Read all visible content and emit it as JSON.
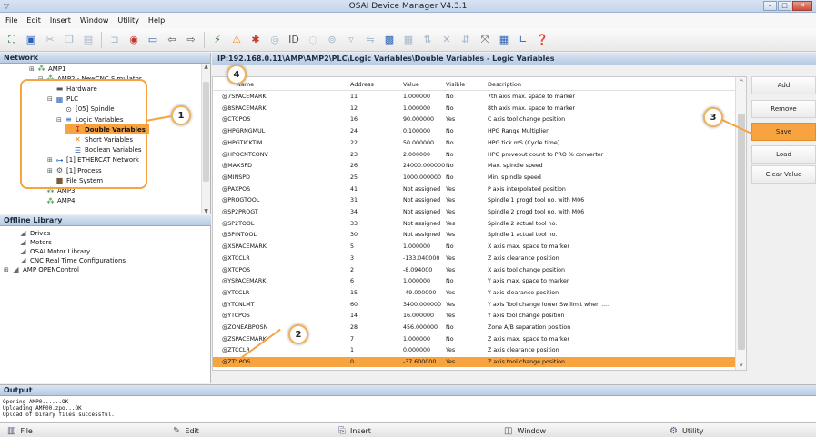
{
  "window": {
    "title": "OSAI Device Manager  V4.3.1"
  },
  "menu": [
    "File",
    "Edit",
    "Insert",
    "Window",
    "Utility",
    "Help"
  ],
  "network": {
    "header": "Network",
    "tree": [
      {
        "label": "AMP1",
        "indent": 0,
        "exp": "⊞",
        "icon": "amp-icon"
      },
      {
        "label": "AMP2 - NewCNC Simulator",
        "indent": 1,
        "exp": "⊟",
        "icon": "amp-icon"
      },
      {
        "label": "Hardware",
        "indent": 2,
        "exp": "",
        "icon": "hardware-icon"
      },
      {
        "label": "PLC",
        "indent": 2,
        "exp": "⊟",
        "icon": "plc-icon"
      },
      {
        "label": "[05] Spindle",
        "indent": 3,
        "exp": "",
        "icon": "spindle-icon"
      },
      {
        "label": "Logic Variables",
        "indent": 3,
        "exp": "⊟",
        "icon": "variables-icon"
      },
      {
        "label": "Double Variables",
        "indent": 4,
        "exp": "",
        "icon": "double-var-icon"
      },
      {
        "label": "Short Variables",
        "indent": 4,
        "exp": "",
        "icon": "short-var-icon"
      },
      {
        "label": "Boolean Variables",
        "indent": 4,
        "exp": "",
        "icon": "bool-var-icon"
      },
      {
        "label": "[1] ETHERCAT Network",
        "indent": 2,
        "exp": "⊞",
        "icon": "ethercat-icon"
      },
      {
        "label": "[1] Process",
        "indent": 2,
        "exp": "⊞",
        "icon": "process-icon"
      },
      {
        "label": "File System",
        "indent": 2,
        "exp": "",
        "icon": "filesystem-icon"
      },
      {
        "label": "AMP3",
        "indent": 1,
        "exp": "",
        "icon": "amp-icon"
      },
      {
        "label": "AMP4",
        "indent": 1,
        "exp": "",
        "icon": "amp-icon"
      }
    ]
  },
  "library": {
    "header": "Offline Library",
    "items": [
      {
        "label": "Drives",
        "indent": 1,
        "exp": ""
      },
      {
        "label": "Motors",
        "indent": 1,
        "exp": ""
      },
      {
        "label": "OSAI Motor Library",
        "indent": 1,
        "exp": ""
      },
      {
        "label": "CNC Real Time Configurations",
        "indent": 1,
        "exp": ""
      },
      {
        "label": "AMP OPENControl",
        "indent": 0,
        "exp": "⊞"
      }
    ]
  },
  "path_bar": "IP:192.168.0.11\\AMP\\AMP2\\PLC\\Logic Variables\\Double Variables - Logic Variables",
  "grid": {
    "columns": [
      "Name",
      "Address",
      "Value",
      "Visible",
      "Description"
    ],
    "rows": [
      [
        "@7SPACEMARK",
        "11",
        "1.000000",
        "No",
        "7th axis max. space to marker"
      ],
      [
        "@8SPACEMARK",
        "12",
        "1.000000",
        "No",
        "8th axis max. space to marker"
      ],
      [
        "@CTCPOS",
        "16",
        "90.000000",
        "Yes",
        "C axis tool change position"
      ],
      [
        "@HPGRNGMUL",
        "24",
        "0.100000",
        "No",
        "HPG Range Multiplier"
      ],
      [
        "@HPGTICKTIM",
        "22",
        "50.000000",
        "No",
        "HPG tick mS (Cycle time)"
      ],
      [
        "@HPOCNTCONV",
        "23",
        "2.000000",
        "No",
        "HPG proveout count to PRO % converter"
      ],
      [
        "@MAXSPD",
        "26",
        "24000.000000",
        "No",
        "Max. spindle speed"
      ],
      [
        "@MINSPD",
        "25",
        "1000.000000",
        "No",
        "Min. spindle speed"
      ],
      [
        "@PAXPOS",
        "41",
        "Not assigned",
        "Yes",
        "P axis interpolated position"
      ],
      [
        "@PROGTOOL",
        "31",
        "Not assigned",
        "Yes",
        "Spindle 1 progd tool no. with M06"
      ],
      [
        "@SP2PROGT",
        "34",
        "Not assigned",
        "Yes",
        "Spindle 2 progd tool no. with M06"
      ],
      [
        "@SP2TOOL",
        "33",
        "Not assigned",
        "Yes",
        "Spindle 2 actual tool no."
      ],
      [
        "@SPINTOOL",
        "30",
        "Not assigned",
        "Yes",
        "Spindle 1 actual tool no."
      ],
      [
        "@XSPACEMARK",
        "5",
        "1.000000",
        "No",
        "X axis max. space to marker"
      ],
      [
        "@XTCCLR",
        "3",
        "-133.040000",
        "Yes",
        "Z axis clearance position"
      ],
      [
        "@XTCPOS",
        "2",
        "-8.094000",
        "Yes",
        "X axis tool change position"
      ],
      [
        "@YSPACEMARK",
        "6",
        "1.000000",
        "No",
        "Y axis max. space to marker"
      ],
      [
        "@YTCCLR",
        "15",
        "-49.000000",
        "Yes",
        "Y axis clearance position"
      ],
      [
        "@YTCNLMT",
        "60",
        "3400.000000",
        "Yes",
        "Y axis Tool change lower Sw limit when ...."
      ],
      [
        "@YTCPOS",
        "14",
        "16.000000",
        "Yes",
        "Y axis tool change position"
      ],
      [
        "@ZONEABPOSN",
        "28",
        "456.000000",
        "No",
        "Zone A/B separation position"
      ],
      [
        "@ZSPACEMARK",
        "7",
        "1.000000",
        "No",
        "Z axis max. space to marker"
      ],
      [
        "@ZTCCLR",
        "1",
        "0.000000",
        "Yes",
        "Z axis clearance position"
      ],
      [
        "@ZTCPOS",
        "0",
        "-37.600000",
        "Yes",
        "Z axis tool change position"
      ]
    ],
    "selected_row": 23
  },
  "side_buttons": [
    {
      "label": "Add"
    },
    {
      "label": "Remove"
    },
    {
      "label": "Save"
    },
    {
      "label": "Load"
    },
    {
      "label": "Clear Value"
    }
  ],
  "callouts": [
    "1",
    "2",
    "3",
    "4"
  ],
  "output": {
    "header": "Output",
    "lines": [
      "Opening AMP0......OK",
      "Uploading AMP00.zpo...OK",
      "Upload of binary files successful."
    ]
  },
  "statusbar": [
    {
      "label": "File",
      "icon": "file-icon"
    },
    {
      "label": "Edit",
      "icon": "edit-icon"
    },
    {
      "label": "Insert",
      "icon": "insert-icon"
    },
    {
      "label": "Window",
      "icon": "window-icon"
    },
    {
      "label": "Utility",
      "icon": "utility-icon"
    }
  ],
  "colors": {
    "accent": "#f7a33f",
    "header": "#b7cbe3"
  }
}
